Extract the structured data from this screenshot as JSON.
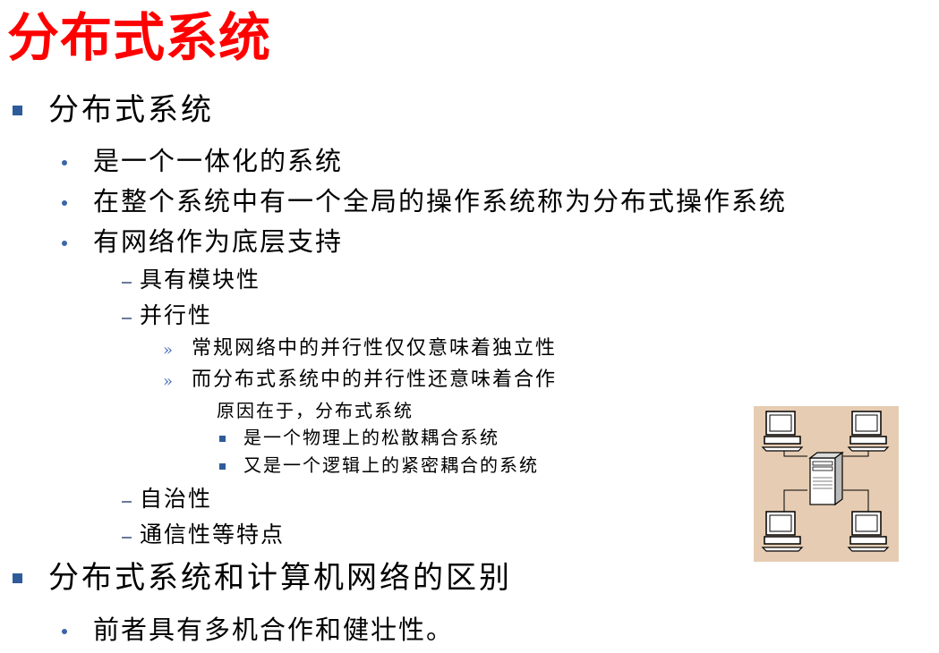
{
  "slide": {
    "title": "分布式系统",
    "items": [
      {
        "level": 1,
        "text": "分布式系统"
      },
      {
        "level": 2,
        "text": "是一个一体化的系统"
      },
      {
        "level": 2,
        "text": "在整个系统中有一个全局的操作系统称为分布式操作系统"
      },
      {
        "level": 2,
        "text": "有网络作为底层支持"
      },
      {
        "level": 3,
        "text": "具有模块性"
      },
      {
        "level": 3,
        "text": "并行性"
      },
      {
        "level": 4,
        "text": "常规网络中的并行性仅仅意味着独立性"
      },
      {
        "level": 4,
        "text": "而分布式系统中的并行性还意味着合作"
      },
      {
        "level": 4,
        "text": "原因在于，分布式系统",
        "continuation": true
      },
      {
        "level": 5,
        "text": "是一个物理上的松散耦合系统"
      },
      {
        "level": 5,
        "text": "又是一个逻辑上的紧密耦合的系统"
      },
      {
        "level": 3,
        "text": "自治性"
      },
      {
        "level": 3,
        "text": "通信性等特点"
      },
      {
        "level": 1,
        "text": "分布式系统和计算机网络的区别"
      },
      {
        "level": 2,
        "text": "前者具有多机合作和健壮性。"
      }
    ]
  },
  "figure": {
    "icons": [
      "desktop-computer-icon",
      "server-tower-icon"
    ],
    "colors": {
      "background": "#e6ccb2",
      "frame": "#000000"
    }
  },
  "colors": {
    "title": "#ff0000",
    "bullet_square": "#2e5c9a",
    "bullet_dot": "#3b66a8",
    "text": "#000000"
  }
}
